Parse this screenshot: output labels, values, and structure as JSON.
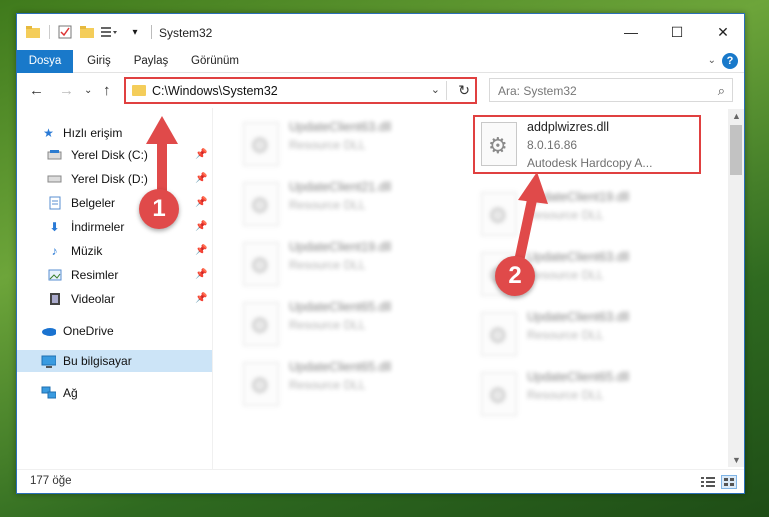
{
  "window": {
    "title": "System32",
    "minimize": "—",
    "maximize": "☐",
    "close": "✕"
  },
  "ribbon": {
    "tabs": [
      "Dosya",
      "Giriş",
      "Paylaş",
      "Görünüm"
    ]
  },
  "address": {
    "path": "C:\\Windows\\System32"
  },
  "search": {
    "placeholder": "Ara: System32"
  },
  "sidebar": {
    "items": [
      {
        "label": "Hızlı erişim",
        "icon": "star-icon",
        "pinned": false
      },
      {
        "label": "Yerel Disk (C:)",
        "icon": "drive-icon",
        "pinned": true
      },
      {
        "label": "Yerel Disk (D:)",
        "icon": "drive-icon",
        "pinned": true
      },
      {
        "label": "Belgeler",
        "icon": "documents-icon",
        "pinned": true
      },
      {
        "label": "İndirmeler",
        "icon": "download-icon",
        "pinned": true
      },
      {
        "label": "Müzik",
        "icon": "music-icon",
        "pinned": true
      },
      {
        "label": "Resimler",
        "icon": "pictures-icon",
        "pinned": true
      },
      {
        "label": "Videolar",
        "icon": "videos-icon",
        "pinned": true
      },
      {
        "label": "OneDrive",
        "icon": "cloud-icon",
        "pinned": false
      },
      {
        "label": "Bu bilgisayar",
        "icon": "computer-icon",
        "pinned": false,
        "selected": true
      },
      {
        "label": "Ağ",
        "icon": "network-icon",
        "pinned": false
      }
    ]
  },
  "files": {
    "left_column": [
      {
        "name": "UpdateClient63.dll",
        "type": "Resource DLL"
      },
      {
        "name": "UpdateClient21.dll",
        "type": "Resource DLL"
      },
      {
        "name": "UpdateClient19.dll",
        "type": "Resource DLL"
      },
      {
        "name": "UpdateClient65.dll",
        "type": "Resource DLL"
      },
      {
        "name": "UpdateClient65.dll",
        "type": "Resource DLL"
      }
    ],
    "right_column": [
      {
        "name": "addplwizres.dll",
        "version": "8.0.16.86",
        "description": "Autodesk Hardcopy A..."
      },
      {
        "name": "UpdateClient19.dll",
        "type": "Resource DLL"
      },
      {
        "name": "UpdateClient63.dll",
        "type": "Resource DLL"
      },
      {
        "name": "UpdateClient63.dll",
        "type": "Resource DLL"
      },
      {
        "name": "UpdateClient65.dll",
        "type": "Resource DLL"
      }
    ]
  },
  "status": {
    "item_count": "177 öğe"
  },
  "annotations": {
    "marker1": "1",
    "marker2": "2",
    "color": "#e04a4a"
  }
}
